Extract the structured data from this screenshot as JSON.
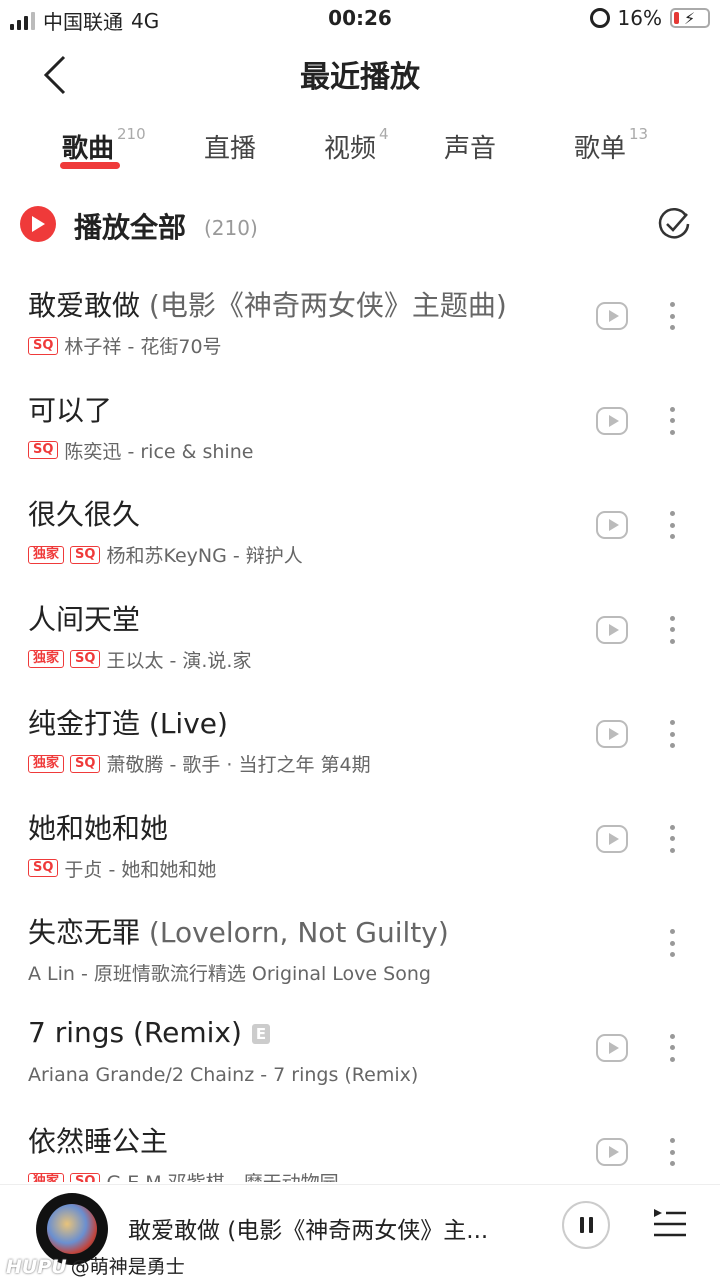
{
  "status_bar": {
    "carrier": "中国联通",
    "network": "4G",
    "time": "00:26",
    "battery": "16%"
  },
  "header": {
    "title": "最近播放"
  },
  "tabs": [
    {
      "label": "歌曲",
      "count": "210"
    },
    {
      "label": "直播",
      "count": ""
    },
    {
      "label": "视频",
      "count": "4"
    },
    {
      "label": "声音",
      "count": ""
    },
    {
      "label": "歌单",
      "count": "13"
    }
  ],
  "play_all": {
    "label": "播放全部",
    "count": "(210)"
  },
  "songs": [
    {
      "title": "敢爱敢做",
      "suffix": " (电影《神奇两女侠》主题曲)",
      "badges": [
        "SQ"
      ],
      "subtitle": "林子祥 - 花街70号"
    },
    {
      "title": "可以了",
      "suffix": "",
      "badges": [
        "SQ"
      ],
      "subtitle": "陈奕迅 - rice & shine"
    },
    {
      "title": "很久很久",
      "suffix": "",
      "badges": [
        "独家",
        "SQ"
      ],
      "subtitle": "杨和苏KeyNG - 辩护人"
    },
    {
      "title": "人间天堂",
      "suffix": "",
      "badges": [
        "独家",
        "SQ"
      ],
      "subtitle": "王以太 - 演.说.家"
    },
    {
      "title": "纯金打造 (Live)",
      "suffix": "",
      "badges": [
        "独家",
        "SQ"
      ],
      "subtitle": "萧敬腾 - 歌手 · 当打之年 第4期"
    },
    {
      "title": "她和她和她",
      "suffix": "",
      "badges": [
        "SQ"
      ],
      "subtitle": "于贞 - 她和她和她"
    },
    {
      "title": "失恋无罪",
      "suffix": " (Lovelorn, Not Guilty)",
      "badges": [],
      "subtitle": "A Lin - 原班情歌流行精选 Original Love Song"
    },
    {
      "title": "7 rings (Remix)",
      "suffix": "",
      "badges": [],
      "explicit": "E",
      "subtitle": "Ariana Grande/2 Chainz - 7 rings (Remix)"
    },
    {
      "title": "依然睡公主",
      "suffix": "",
      "badges": [
        "独家",
        "SQ"
      ],
      "subtitle": "G.E.M.邓紫棋 - 摩天动物园"
    }
  ],
  "mini_player": {
    "title": "敢爱敢做 (电影《神奇两女侠》主..."
  },
  "watermark": {
    "brand": "HUPU",
    "text": "@萌神是勇士"
  },
  "colors": {
    "accent": "#ef3a3a",
    "text": "#222222",
    "muted": "#999999"
  }
}
